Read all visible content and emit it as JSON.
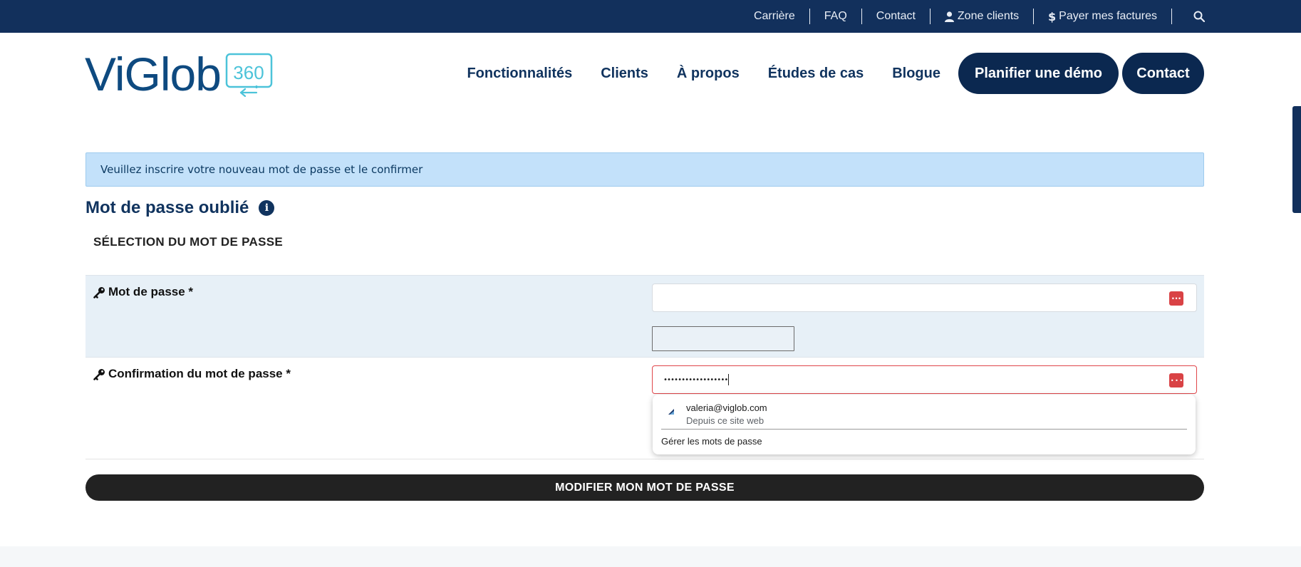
{
  "top_nav": {
    "links": [
      {
        "label": "Carrière"
      },
      {
        "label": "FAQ"
      },
      {
        "label": "Contact"
      },
      {
        "label": "Zone clients",
        "icon": "user-icon"
      },
      {
        "label": "Payer mes factures",
        "icon": "dollar-icon"
      }
    ],
    "search_icon": "search-icon"
  },
  "header": {
    "logo_text": "ViGlob",
    "logo_badge": "360",
    "nav": [
      {
        "label": "Fonctionnalités"
      },
      {
        "label": "Clients"
      },
      {
        "label": "À propos"
      },
      {
        "label": "Études de cas"
      },
      {
        "label": "Blogue"
      }
    ],
    "demo_button": "Planifier une démo",
    "contact_button": "Contact"
  },
  "alert": {
    "message": "Veuillez inscrire votre nouveau mot de passe et le confirmer"
  },
  "page": {
    "title": "Mot de passe oublié",
    "section_title": "SÉLECTION DU MOT DE PASSE"
  },
  "form": {
    "password_label": "Mot de passe *",
    "password_value": "",
    "confirm_label": "Confirmation du mot de passe *",
    "confirm_value": "••••••••••••••••••"
  },
  "autofill": {
    "account_email": "valeria@viglob.com",
    "account_source": "Depuis ce site web",
    "manage_label": "Gérer les mots de passe"
  },
  "submit": {
    "label": "MODIFIER MON MOT DE PASSE"
  },
  "colors": {
    "brand_navy": "#12305c",
    "accent_teal": "#4cc3d9",
    "alert_bg": "#c3e1fa",
    "error_red": "#e0464a"
  }
}
